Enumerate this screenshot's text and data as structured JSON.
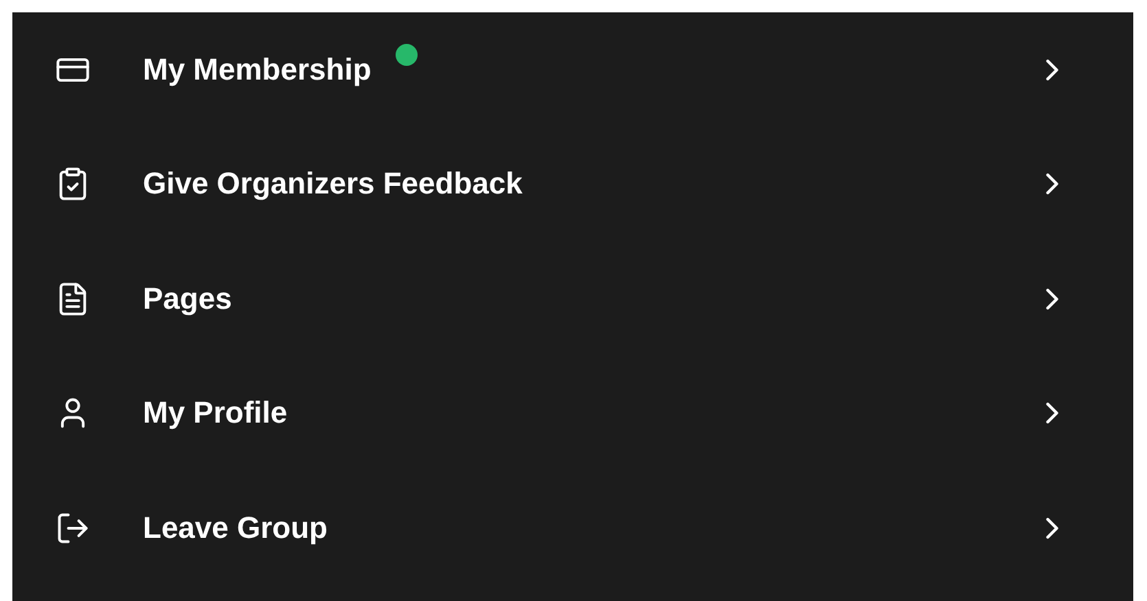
{
  "menu": {
    "items": [
      {
        "label": "My Membership",
        "kind": "card",
        "unread": true
      },
      {
        "label": "Give Organizers Feedback",
        "kind": "clipboard",
        "unread": false
      },
      {
        "label": "Pages",
        "kind": "file",
        "unread": false
      },
      {
        "label": "My Profile",
        "kind": "user",
        "unread": false
      },
      {
        "label": "Leave Group",
        "kind": "logout",
        "unread": false
      }
    ]
  }
}
